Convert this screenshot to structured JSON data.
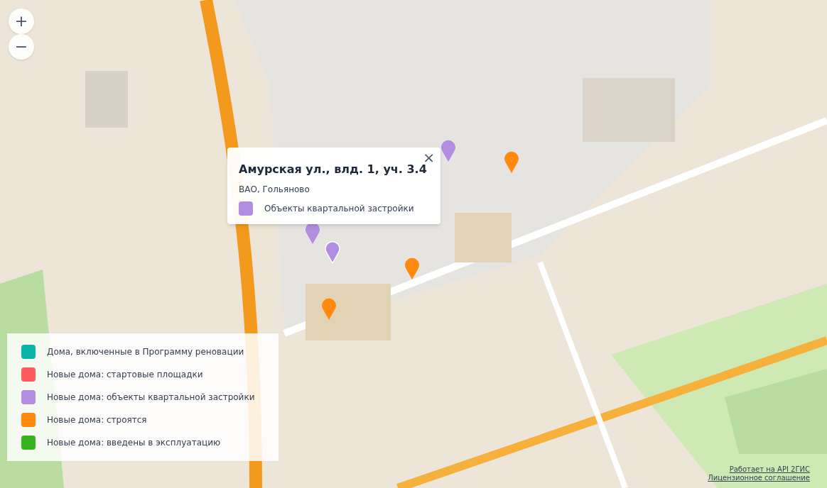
{
  "zoom_controls": [
    {
      "label": "+"
    },
    {
      "label": "−"
    }
  ],
  "markers": [
    {
      "color": "#b28de0",
      "selected": false
    },
    {
      "color": "#b28de0",
      "selected": false
    },
    {
      "color": "#b28de0",
      "selected": true
    },
    {
      "color": "#ff8a0d",
      "selected": false
    },
    {
      "color": "#ff8a0d",
      "selected": false
    },
    {
      "color": "#ff8a0d",
      "selected": false
    }
  ],
  "popup": {
    "title": "Амурская ул., влд. 1, уч. 3.4",
    "subtitle": "ВАО, Гольяново",
    "category": {
      "label": "Объекты квартальной застройки",
      "color": "#b28de0"
    },
    "close": "×"
  },
  "legend": [
    {
      "label": "Дома, включенные в Программу реновации",
      "color": "#0db2a8"
    },
    {
      "label": "Новые дома: стартовые площадки",
      "color": "#ff5a5f"
    },
    {
      "label": "Новые дома: объекты квартальной застройки",
      "color": "#b28de0"
    },
    {
      "label": "Новые дома: строятся",
      "color": "#ff8a0d"
    },
    {
      "label": "Новые дома: введены в эксплуатацию",
      "color": "#36b21c"
    }
  ],
  "attribution": [
    "Работает на API 2ГИС",
    "Лицензионное соглашение"
  ]
}
